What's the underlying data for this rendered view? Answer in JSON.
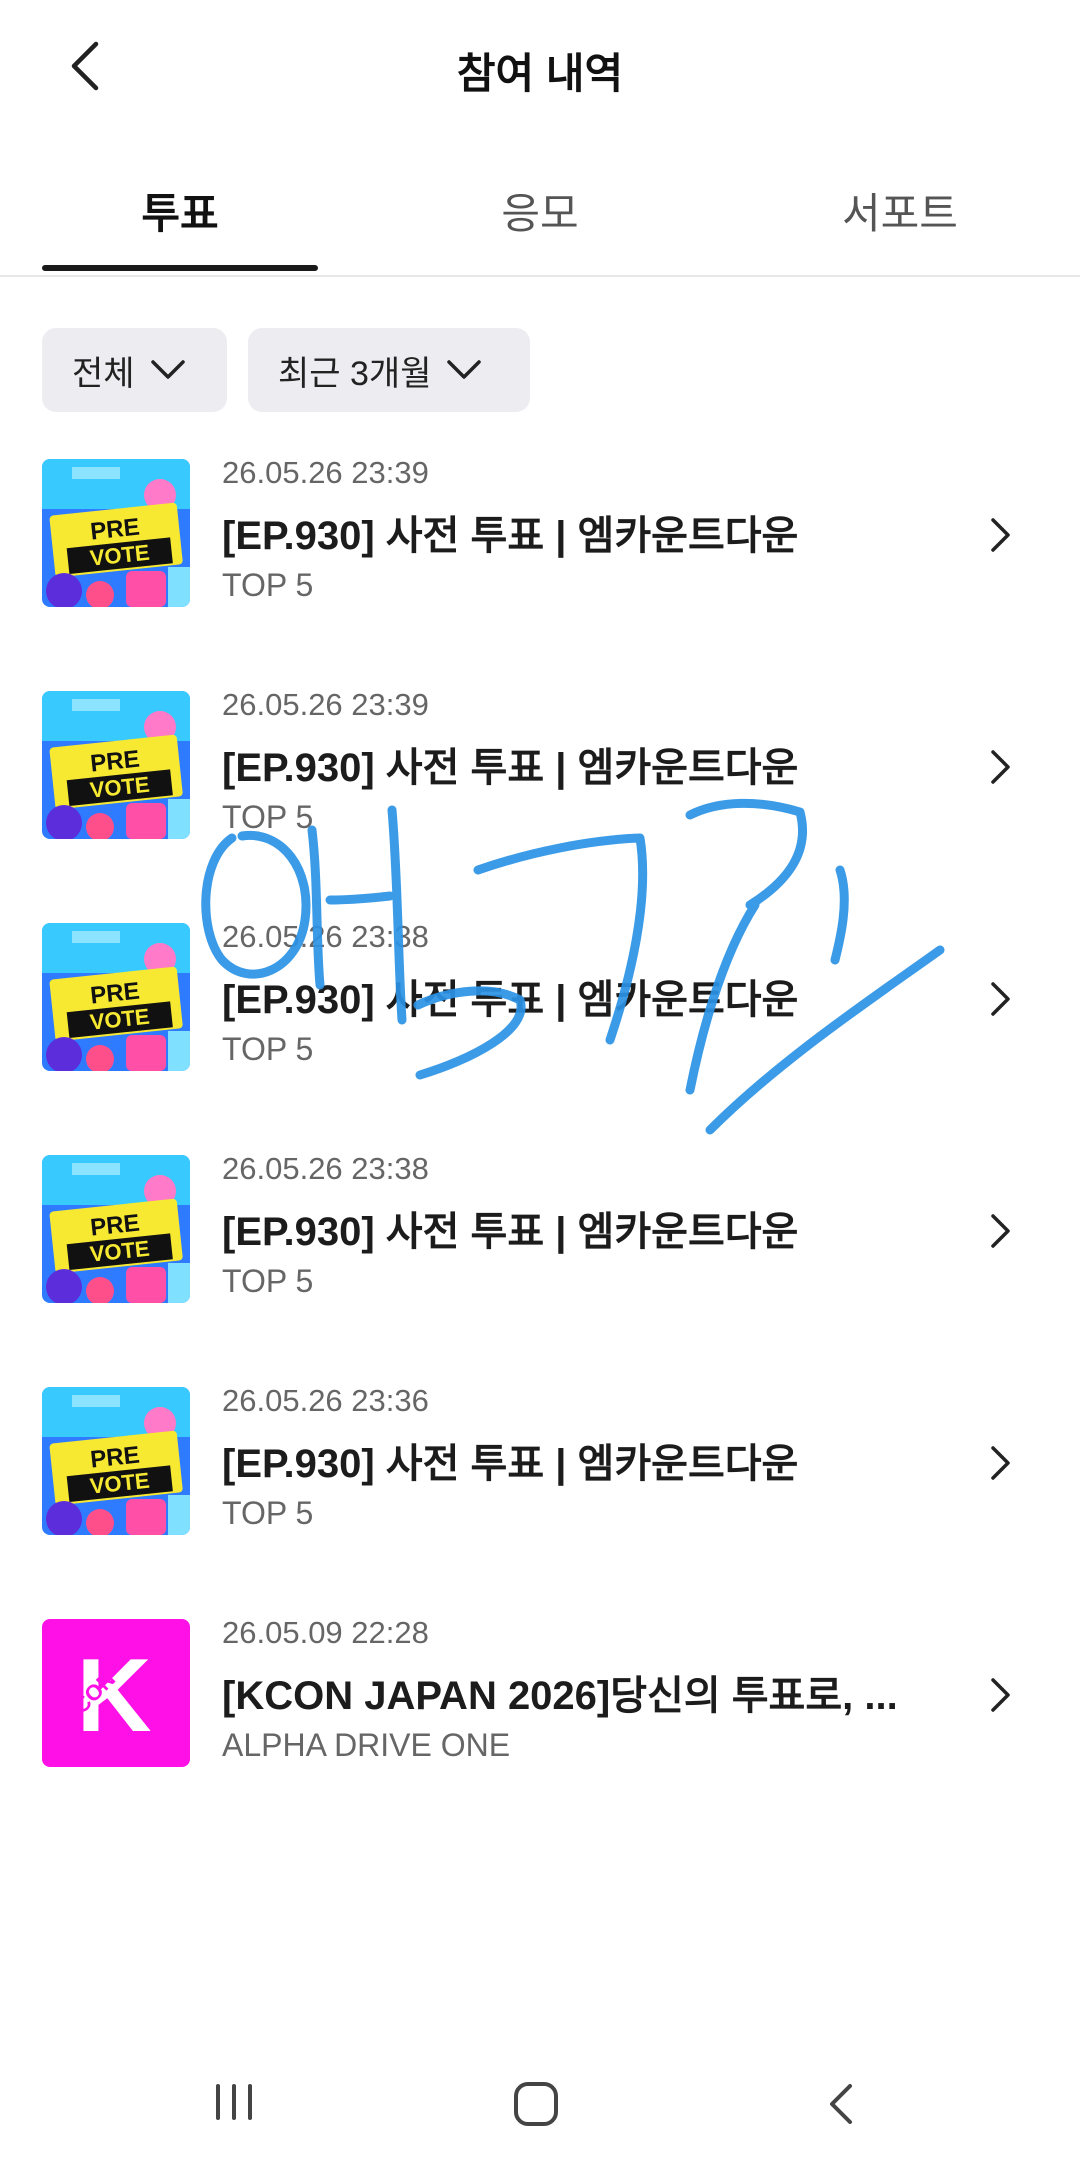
{
  "header": {
    "title": "참여 내역"
  },
  "tabs": [
    {
      "label": "투표",
      "active": true
    },
    {
      "label": "응모",
      "active": false
    },
    {
      "label": "서포트",
      "active": false
    }
  ],
  "filters": [
    {
      "label": "전체"
    },
    {
      "label": "최근 3개월"
    }
  ],
  "items": [
    {
      "date": "26.05.26 23:39",
      "title": "[EP.930] 사전 투표 | 엠카운트다운",
      "subtitle": "TOP 5",
      "thumb": "prevote",
      "thumb_text": [
        "PRE",
        "VOTE"
      ]
    },
    {
      "date": "26.05.26 23:39",
      "title": "[EP.930] 사전 투표 | 엠카운트다운",
      "subtitle": "TOP 5",
      "thumb": "prevote",
      "thumb_text": [
        "PRE",
        "VOTE"
      ]
    },
    {
      "date": "26.05.26 23:38",
      "title": "[EP.930] 사전 투표 | 엠카운트다운",
      "subtitle": "TOP 5",
      "thumb": "prevote",
      "thumb_text": [
        "PRE",
        "VOTE"
      ]
    },
    {
      "date": "26.05.26 23:38",
      "title": "[EP.930] 사전 투표 | 엠카운트다운",
      "subtitle": "TOP 5",
      "thumb": "prevote",
      "thumb_text": [
        "PRE",
        "VOTE"
      ]
    },
    {
      "date": "26.05.26 23:36",
      "title": "[EP.930] 사전 투표 | 엠카운트다운",
      "subtitle": "TOP 5",
      "thumb": "prevote",
      "thumb_text": [
        "PRE",
        "VOTE"
      ]
    },
    {
      "date": "26.05.09 22:28",
      "title": "[KCON JAPAN 2026]당신의 투표로, ...",
      "subtitle": "ALPHA DRIVE ONE",
      "thumb": "kcon",
      "thumb_text": [
        "K",
        "CON"
      ]
    }
  ],
  "icons": {
    "back": "chevron-left-icon",
    "filter_arrow": "chevron-down-icon",
    "row_arrow": "chevron-right-icon",
    "nav_recent": "recent-apps-icon",
    "nav_home": "home-icon",
    "nav_back": "back-icon"
  },
  "colors": {
    "accent": "#1a1a1a",
    "chip_bg": "#ececf1",
    "kcon_magenta": "#ff10e6",
    "scribble_blue": "#2b93e6"
  }
}
